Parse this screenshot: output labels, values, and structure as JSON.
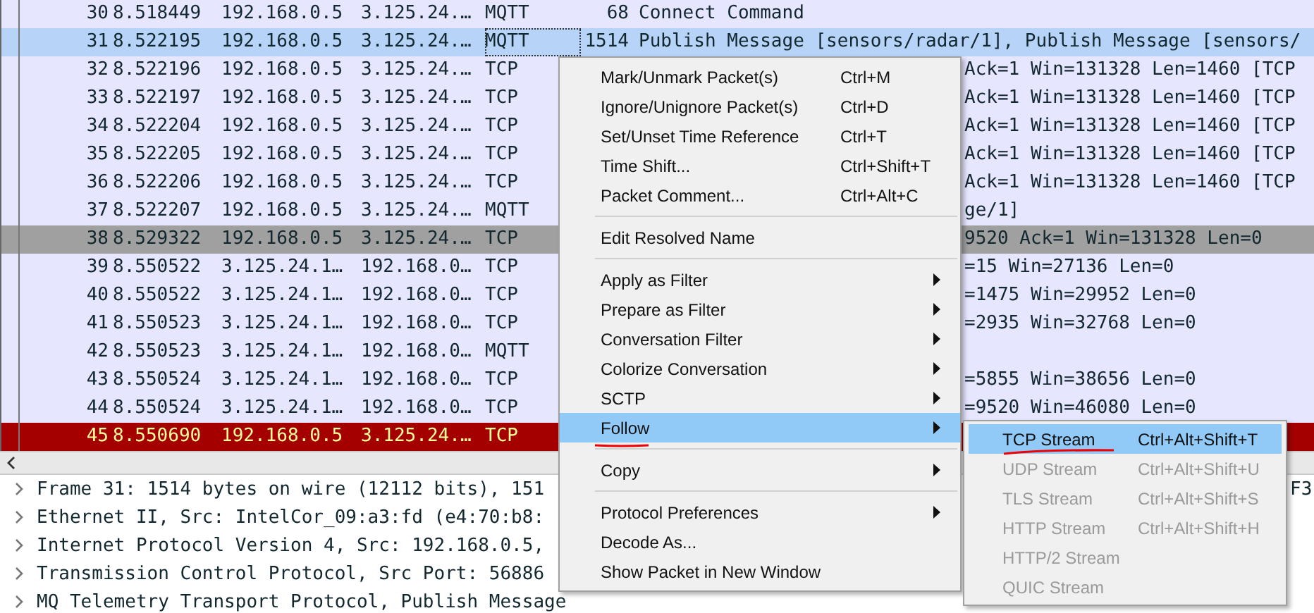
{
  "packet_list": {
    "rows": [
      {
        "no": "30",
        "time": "8.518449",
        "source": "192.168.0.5",
        "destination": "3.125.24.…",
        "protocol": "MQTT",
        "length": "68",
        "info": "Connect Command",
        "color": "#e7e6ff",
        "selected": false
      },
      {
        "no": "31",
        "time": "8.522195",
        "source": "192.168.0.5",
        "destination": "3.125.24.…",
        "protocol": "MQTT",
        "length": "1514",
        "info": "Publish Message [sensors/radar/1], Publish Message [sensors/",
        "selected": true
      },
      {
        "no": "32",
        "time": "8.522196",
        "source": "192.168.0.5",
        "destination": "3.125.24.…",
        "protocol": "TCP",
        "info_tail": "Ack=1 Win=131328 Len=1460 [TCP",
        "color": "#e7e6ff",
        "selected": false
      },
      {
        "no": "33",
        "time": "8.522197",
        "source": "192.168.0.5",
        "destination": "3.125.24.…",
        "protocol": "TCP",
        "info_tail": "Ack=1 Win=131328 Len=1460 [TCP",
        "color": "#e7e6ff",
        "selected": false
      },
      {
        "no": "34",
        "time": "8.522204",
        "source": "192.168.0.5",
        "destination": "3.125.24.…",
        "protocol": "TCP",
        "info_tail": "Ack=1 Win=131328 Len=1460 [TCP",
        "color": "#e7e6ff",
        "selected": false
      },
      {
        "no": "35",
        "time": "8.522205",
        "source": "192.168.0.5",
        "destination": "3.125.24.…",
        "protocol": "TCP",
        "info_tail": "Ack=1 Win=131328 Len=1460 [TCP",
        "color": "#e7e6ff",
        "selected": false
      },
      {
        "no": "36",
        "time": "8.522206",
        "source": "192.168.0.5",
        "destination": "3.125.24.…",
        "protocol": "TCP",
        "info_tail": "Ack=1 Win=131328 Len=1460 [TCP",
        "color": "#e7e6ff",
        "selected": false
      },
      {
        "no": "37",
        "time": "8.522207",
        "source": "192.168.0.5",
        "destination": "3.125.24.…",
        "protocol": "MQTT",
        "info_tail": "ge/1]",
        "color": "#e7e6ff",
        "selected": false
      },
      {
        "no": "38",
        "time": "8.529322",
        "source": "192.168.0.5",
        "destination": "3.125.24.…",
        "protocol": "TCP",
        "info_tail": "9520 Ack=1 Win=131328 Len=0",
        "color": "#a0a0a0",
        "selected": false
      },
      {
        "no": "39",
        "time": "8.550522",
        "source": "3.125.24.1…",
        "destination": "192.168.0…",
        "protocol": "TCP",
        "info_tail": "=15 Win=27136 Len=0",
        "color": "#e7e6ff",
        "selected": false
      },
      {
        "no": "40",
        "time": "8.550522",
        "source": "3.125.24.1…",
        "destination": "192.168.0…",
        "protocol": "TCP",
        "info_tail": "=1475 Win=29952 Len=0",
        "color": "#e7e6ff",
        "selected": false
      },
      {
        "no": "41",
        "time": "8.550523",
        "source": "3.125.24.1…",
        "destination": "192.168.0…",
        "protocol": "TCP",
        "info_tail": "=2935 Win=32768 Len=0",
        "color": "#e7e6ff",
        "selected": false
      },
      {
        "no": "42",
        "time": "8.550523",
        "source": "3.125.24.1…",
        "destination": "192.168.0…",
        "protocol": "MQTT",
        "color": "#e7e6ff",
        "selected": false
      },
      {
        "no": "43",
        "time": "8.550524",
        "source": "3.125.24.1…",
        "destination": "192.168.0…",
        "protocol": "TCP",
        "info_tail": "=5855 Win=38656 Len=0",
        "color": "#e7e6ff",
        "selected": false
      },
      {
        "no": "44",
        "time": "8.550524",
        "source": "3.125.24.1…",
        "destination": "192.168.0…",
        "protocol": "TCP",
        "info_tail": "=9520 Win=46080 Len=0",
        "color": "#e7e6ff",
        "selected": false
      },
      {
        "no": "45",
        "time": "8.550690",
        "source": "192.168.0.5",
        "destination": "3.125.24.…",
        "protocol": "TCP",
        "color": "#a40000",
        "selected": false
      }
    ]
  },
  "details": [
    {
      "text": "Frame 31: 1514 bytes on wire (12112 bits), 151",
      "tail": "F3",
      "expanded": false
    },
    {
      "text": "Ethernet II, Src: IntelCor_09:a3:fd (e4:70:b8:",
      "expanded": false
    },
    {
      "text": "Internet Protocol Version 4, Src: 192.168.0.5,",
      "expanded": false
    },
    {
      "text": "Transmission Control Protocol, Src Port: 56886",
      "expanded": false
    },
    {
      "text": "MQ Telemetry Transport Protocol, Publish Message",
      "expanded": false
    }
  ],
  "context_menu": {
    "items": [
      {
        "kind": "item",
        "label": "Mark/Unmark Packet(s)",
        "shortcut": "Ctrl+M"
      },
      {
        "kind": "item",
        "label": "Ignore/Unignore Packet(s)",
        "shortcut": "Ctrl+D"
      },
      {
        "kind": "item",
        "label": "Set/Unset Time Reference",
        "shortcut": "Ctrl+T"
      },
      {
        "kind": "item",
        "label": "Time Shift...",
        "shortcut": "Ctrl+Shift+T"
      },
      {
        "kind": "item",
        "label": "Packet Comment...",
        "shortcut": "Ctrl+Alt+C"
      },
      {
        "kind": "separator"
      },
      {
        "kind": "item",
        "label": "Edit Resolved Name"
      },
      {
        "kind": "separator"
      },
      {
        "kind": "submenu",
        "label": "Apply as Filter",
        "selected": false
      },
      {
        "kind": "submenu",
        "label": "Prepare as Filter",
        "selected": false
      },
      {
        "kind": "submenu",
        "label": "Conversation Filter",
        "selected": false
      },
      {
        "kind": "submenu",
        "label": "Colorize Conversation",
        "selected": false
      },
      {
        "kind": "submenu",
        "label": "SCTP",
        "selected": false
      },
      {
        "kind": "submenu",
        "label": "Follow",
        "selected": true
      },
      {
        "kind": "separator"
      },
      {
        "kind": "submenu",
        "label": "Copy",
        "selected": false
      },
      {
        "kind": "separator"
      },
      {
        "kind": "submenu",
        "label": "Protocol Preferences",
        "selected": false
      },
      {
        "kind": "item",
        "label": "Decode As..."
      },
      {
        "kind": "item",
        "label": "Show Packet in New Window"
      }
    ]
  },
  "follow_submenu": {
    "items": [
      {
        "label": "TCP Stream",
        "shortcut": "Ctrl+Alt+Shift+T",
        "selected": true,
        "disabled": false
      },
      {
        "label": "UDP Stream",
        "shortcut": "Ctrl+Alt+Shift+U",
        "selected": false,
        "disabled": true
      },
      {
        "label": "TLS Stream",
        "shortcut": "Ctrl+Alt+Shift+S",
        "selected": false,
        "disabled": true
      },
      {
        "label": "HTTP Stream",
        "shortcut": "Ctrl+Alt+Shift+H",
        "selected": false,
        "disabled": true
      },
      {
        "label": "HTTP/2 Stream",
        "selected": false,
        "disabled": true
      },
      {
        "label": "QUIC Stream",
        "selected": false,
        "disabled": true
      }
    ]
  }
}
